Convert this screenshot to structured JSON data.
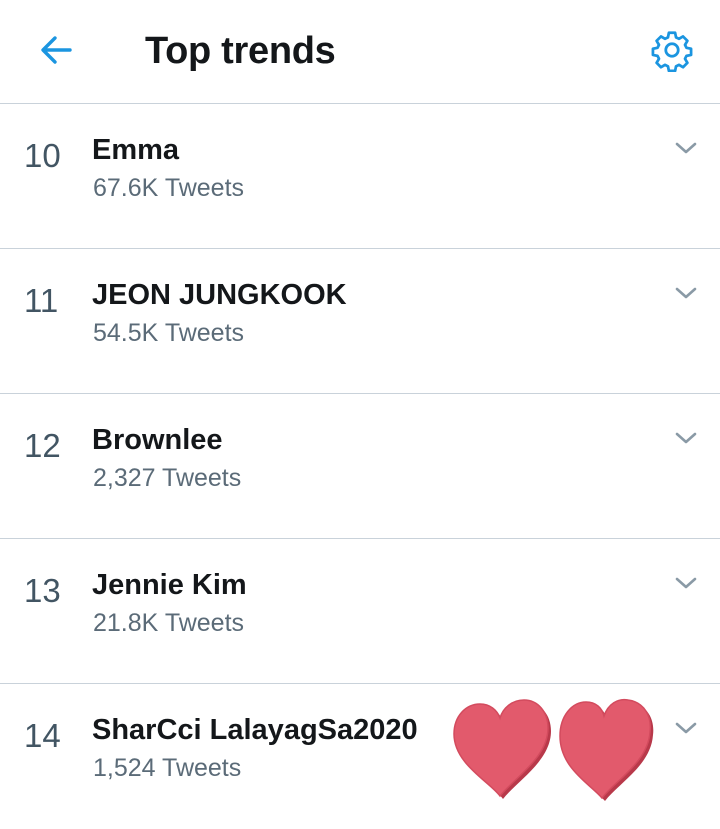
{
  "header": {
    "title": "Top trends",
    "back_icon": "arrow-left-icon",
    "settings_icon": "gear-icon"
  },
  "trends": [
    {
      "rank": "10",
      "name": "Emma",
      "count": "67.6K Tweets"
    },
    {
      "rank": "11",
      "name": "JEON JUNGKOOK",
      "count": "54.5K Tweets"
    },
    {
      "rank": "12",
      "name": "Brownlee",
      "count": "2,327 Tweets"
    },
    {
      "rank": "13",
      "name": "Jennie Kim",
      "count": "21.8K Tweets"
    },
    {
      "rank": "14",
      "name": "SharCci LalayagSa2020",
      "count": "1,524 Tweets"
    }
  ],
  "colors": {
    "accent": "#1da1f2",
    "text_primary": "#14171a",
    "text_secondary": "#5b6b78",
    "divider": "#c9d2da",
    "heart": "#e25a6c"
  }
}
